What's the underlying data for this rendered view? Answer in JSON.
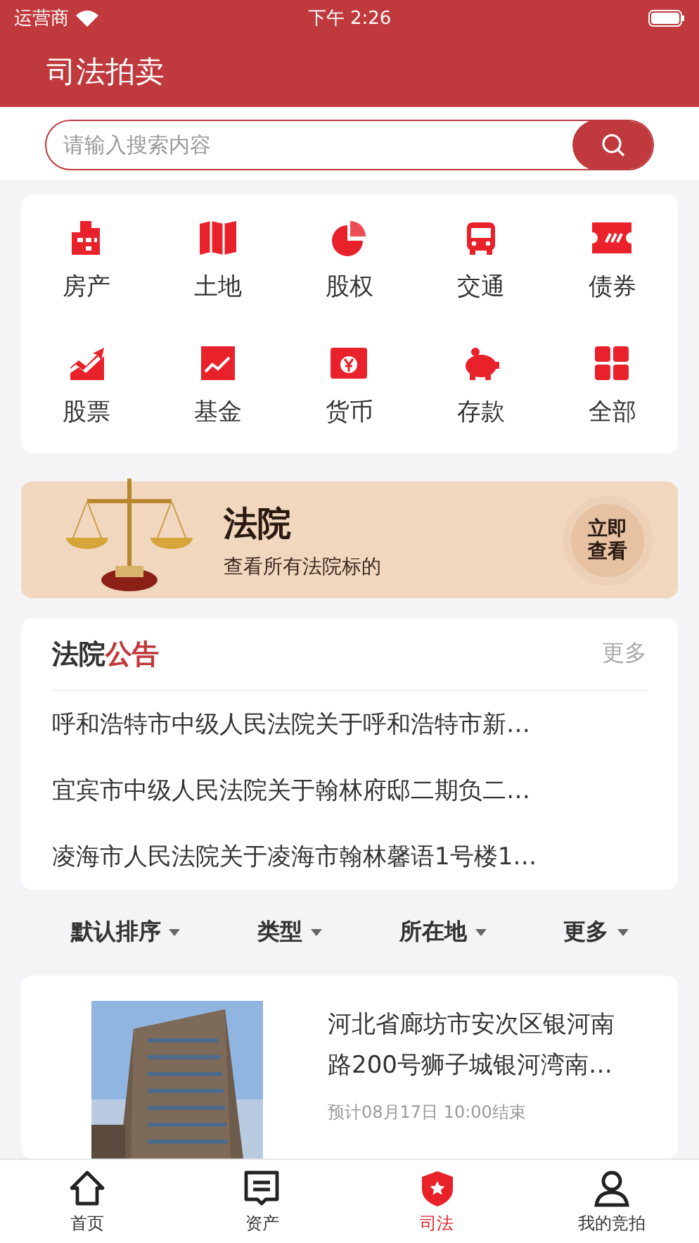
{
  "status_bar": {
    "carrier": "运营商",
    "time": "下午 2:26"
  },
  "header": {
    "title": "司法拍卖"
  },
  "search": {
    "placeholder": "请输入搜索内容"
  },
  "categories": [
    {
      "label": "房产"
    },
    {
      "label": "土地"
    },
    {
      "label": "股权"
    },
    {
      "label": "交通"
    },
    {
      "label": "债券"
    },
    {
      "label": "股票"
    },
    {
      "label": "基金"
    },
    {
      "label": "货币"
    },
    {
      "label": "存款"
    },
    {
      "label": "全部"
    }
  ],
  "banner": {
    "title": "法院",
    "subtitle": "查看所有法院标的",
    "button": "立即查看"
  },
  "notices": {
    "title_main": "法院",
    "title_accent": "公告",
    "more": "更多",
    "items": [
      "呼和浩特市中级人民法院关于呼和浩特市新…",
      "宜宾市中级人民法院关于翰林府邸二期负二…",
      "凌海市人民法院关于凌海市翰林馨语1号楼1…"
    ]
  },
  "filters": [
    "默认排序",
    "类型",
    "所在地",
    "更多"
  ],
  "listing": {
    "kind": "picture",
    "title": "河北省廊坊市安次区银河南路200号狮子城银河湾南…",
    "time": "预计08月17日 10:00结束"
  },
  "tab_bar": [
    {
      "label": "首页",
      "selected": false
    },
    {
      "label": "资产",
      "selected": false
    },
    {
      "label": "司法",
      "selected": true
    },
    {
      "label": "我的竞拍",
      "selected": false
    }
  ]
}
